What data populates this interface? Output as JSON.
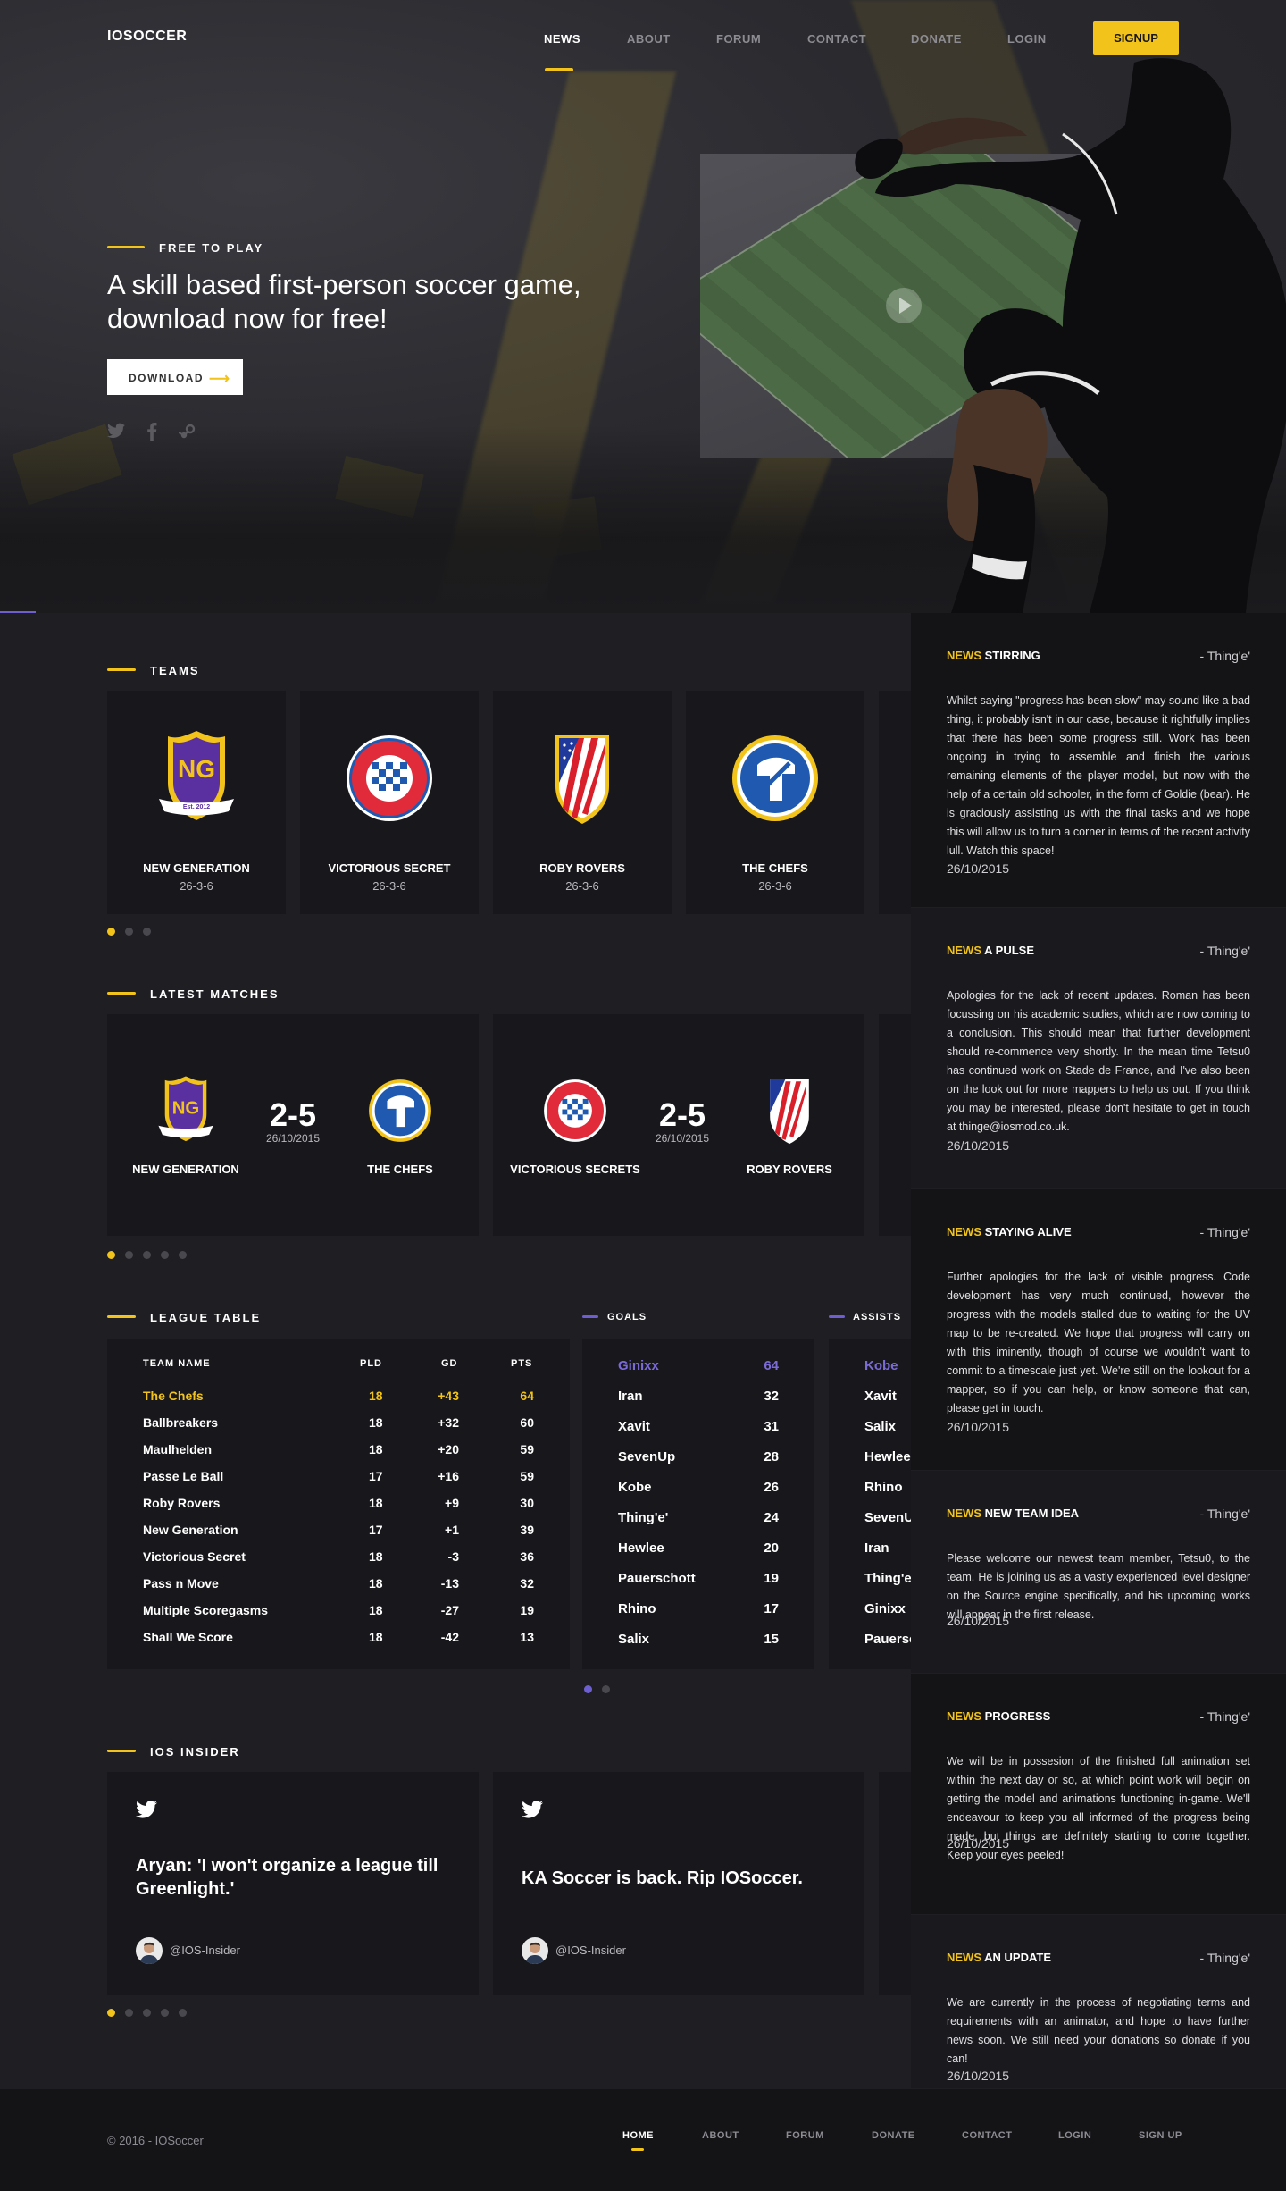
{
  "nav": {
    "logo": "IOSOCCER",
    "items": [
      "NEWS",
      "ABOUT",
      "FORUM",
      "CONTACT",
      "DONATE",
      "LOGIN"
    ],
    "active": "NEWS",
    "signup": "SIGNUP"
  },
  "hero": {
    "eyebrow": "FREE TO PLAY",
    "headline": "A skill based first-person soccer game, download now for free!",
    "download_label": "DOWNLOAD",
    "social_icons": [
      "twitter-icon",
      "facebook-icon",
      "steam-icon"
    ],
    "video_play_icon": "play-icon"
  },
  "teams": {
    "title": "TEAMS",
    "items": [
      {
        "name": "NEW GENERATION",
        "record": "26-3-6",
        "crest_text": "NG",
        "crest_sub": "Est. 2012"
      },
      {
        "name": "VICTORIOUS SECRET",
        "record": "26-3-6"
      },
      {
        "name": "ROBY ROVERS",
        "record": "26-3-6"
      },
      {
        "name": "THE CHEFS",
        "record": "26-3-6"
      }
    ],
    "pages": 3,
    "active_page": 1
  },
  "matches": {
    "title": "LATEST MATCHES",
    "items": [
      {
        "home": "NEW GENERATION",
        "away": "THE CHEFS",
        "score": "2-5",
        "date": "26/10/2015"
      },
      {
        "home": "VICTORIOUS SECRETS",
        "away": "ROBY ROVERS",
        "score": "2-5",
        "date": "26/10/2015"
      }
    ],
    "pages": 5,
    "active_page": 1
  },
  "league": {
    "title": "LEAGUE TABLE",
    "headers": [
      "TEAM NAME",
      "PLD",
      "GD",
      "PTS"
    ],
    "rows": [
      [
        "The Chefs",
        "18",
        "+43",
        "64"
      ],
      [
        "Ballbreakers",
        "18",
        "+32",
        "60"
      ],
      [
        "Maulhelden",
        "18",
        "+20",
        "59"
      ],
      [
        "Passe Le Ball",
        "17",
        "+16",
        "59"
      ],
      [
        "Roby Rovers",
        "18",
        "+9",
        "30"
      ],
      [
        "New Generation",
        "17",
        "+1",
        "39"
      ],
      [
        "Victorious Secret",
        "18",
        "-3",
        "36"
      ],
      [
        "Pass n Move",
        "18",
        "-13",
        "32"
      ],
      [
        "Multiple Scoregasms",
        "18",
        "-27",
        "19"
      ],
      [
        "Shall We Score",
        "18",
        "-42",
        "13"
      ]
    ]
  },
  "goals": {
    "title": "GOALS",
    "rows": [
      [
        "Ginixx",
        "64"
      ],
      [
        "Iran",
        "32"
      ],
      [
        "Xavit",
        "31"
      ],
      [
        "SevenUp",
        "28"
      ],
      [
        "Kobe",
        "26"
      ],
      [
        "Thing'e'",
        "24"
      ],
      [
        "Hewlee",
        "20"
      ],
      [
        "Pauerschott",
        "19"
      ],
      [
        "Rhino",
        "17"
      ],
      [
        "Salix",
        "15"
      ]
    ]
  },
  "assists": {
    "title": "ASSISTS",
    "rows": [
      [
        "Kobe",
        ""
      ],
      [
        "Xavit",
        ""
      ],
      [
        "Salix",
        ""
      ],
      [
        "Hewlee",
        ""
      ],
      [
        "Rhino",
        ""
      ],
      [
        "SevenUp",
        ""
      ],
      [
        "Iran",
        ""
      ],
      [
        "Thing'e'",
        ""
      ],
      [
        "Ginixx",
        ""
      ],
      [
        "Pauerschott",
        ""
      ]
    ]
  },
  "stats_pages": 2,
  "insider": {
    "title": "IOS INSIDER",
    "tweets": [
      {
        "text": "Aryan: 'I won't organize a league till Greenlight.'",
        "handle": "@IOS-Insider"
      },
      {
        "text": "KA Soccer is back. Rip IOSoccer.",
        "handle": "@IOS-Insider"
      }
    ],
    "pages": 5,
    "active_page": 1
  },
  "news": [
    {
      "tag": "NEWS",
      "title": "STIRRING",
      "author": "- Thing'e'",
      "body": "Whilst saying \"progress has been slow\" may sound like a bad thing, it probably isn't in our case, because it rightfully implies that there has been some progress still. Work has been ongoing in trying to assemble and finish the various remaining elements of the player model, but now with the help of a certain old schooler, in the form of Goldie (bear). He is graciously assisting us with the final tasks and we hope this will allow us to turn a corner in terms of the recent activity lull. Watch this space!",
      "date": "26/10/2015"
    },
    {
      "tag": "NEWS",
      "title": "A PULSE",
      "author": "- Thing'e'",
      "body": "Apologies for the lack of recent updates. Roman has been focussing on his academic studies, which are now coming to a conclusion. This should mean that further development should re-commence very shortly. In the mean time Tetsu0 has continued work on Stade de France, and I've also been on the look out for more mappers to help us out. If you think you may be interested, please don't hesitate to get in touch at thinge@iosmod.co.uk.",
      "date": "26/10/2015"
    },
    {
      "tag": "NEWS",
      "title": "STAYING ALIVE",
      "author": "- Thing'e'",
      "body": "Further apologies for the lack of visible progress. Code development has very much continued, however the progress with the models stalled due to waiting for the UV map to be re-created. We hope that progress will carry on with this iminently, though of course we wouldn't want to commit to a timescale just yet. We're still on the lookout for a mapper, so if you can help, or know someone that can, please get in touch.",
      "date": "26/10/2015"
    },
    {
      "tag": "NEWS",
      "title": "NEW TEAM IDEA",
      "author": "- Thing'e'",
      "body": "Please welcome our newest team member, Tetsu0, to the team. He is joining us as a vastly experienced level designer on the Source engine specifically, and his upcoming works will appear in the first release.",
      "date": "26/10/2015"
    },
    {
      "tag": "NEWS",
      "title": "PROGRESS",
      "author": "- Thing'e'",
      "body": "We will be in possesion of the finished full animation set within the next day or so, at which point work will begin on getting the model and animations functioning in-game. We'll endeavour to keep you all informed of the progress being made, but things are definitely starting to come together. Keep your eyes peeled!",
      "date": "26/10/2015"
    },
    {
      "tag": "NEWS",
      "title": "AN UPDATE",
      "author": "- Thing'e'",
      "body": "We are currently in the process of negotiating terms and requirements with an animator, and hope to have further news soon. We still need your donations so donate if you can!",
      "date": "26/10/2015"
    }
  ],
  "footer": {
    "copyright": "© 2016 - IOSoccer",
    "links": [
      "HOME",
      "ABOUT",
      "FORUM",
      "DONATE",
      "CONTACT",
      "LOGIN",
      "SIGN UP"
    ],
    "active": "HOME"
  },
  "colors": {
    "accent": "#f2c31b",
    "purple": "#6d5fcf",
    "card": "#18181c",
    "bg": "#1e1e23"
  }
}
